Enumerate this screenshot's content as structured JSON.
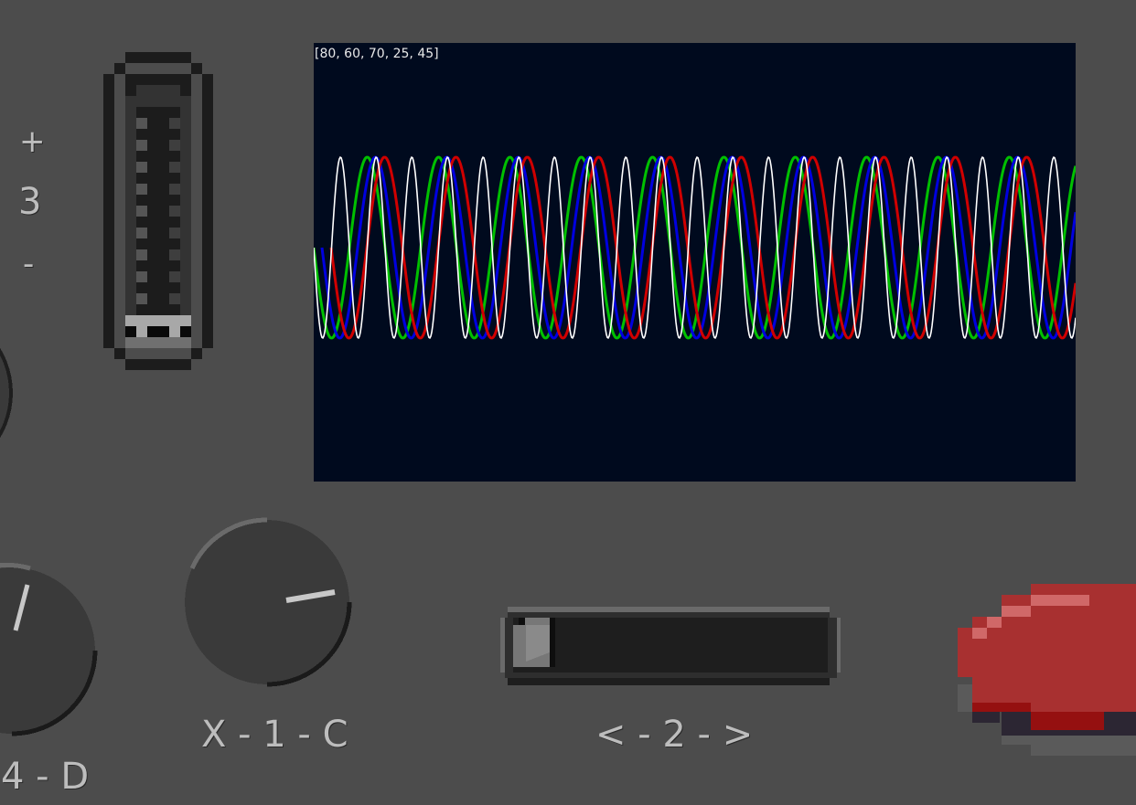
{
  "scope": {
    "label": "[80, 60, 70, 25, 45]",
    "background": "#000a1e",
    "trace_colors": [
      "#ffffff",
      "#00c000",
      "#0000e0",
      "#d00000"
    ]
  },
  "vertical_slider": {
    "plus_label": "+",
    "value": "3",
    "minus_label": "-",
    "position": "bottom"
  },
  "knob_1": {
    "label": "X - 1 - C"
  },
  "knob_4": {
    "label": "4 - D"
  },
  "horizontal_slider": {
    "label": "< - 2 - >",
    "position": "left"
  },
  "button": {
    "color": "#a83030"
  }
}
